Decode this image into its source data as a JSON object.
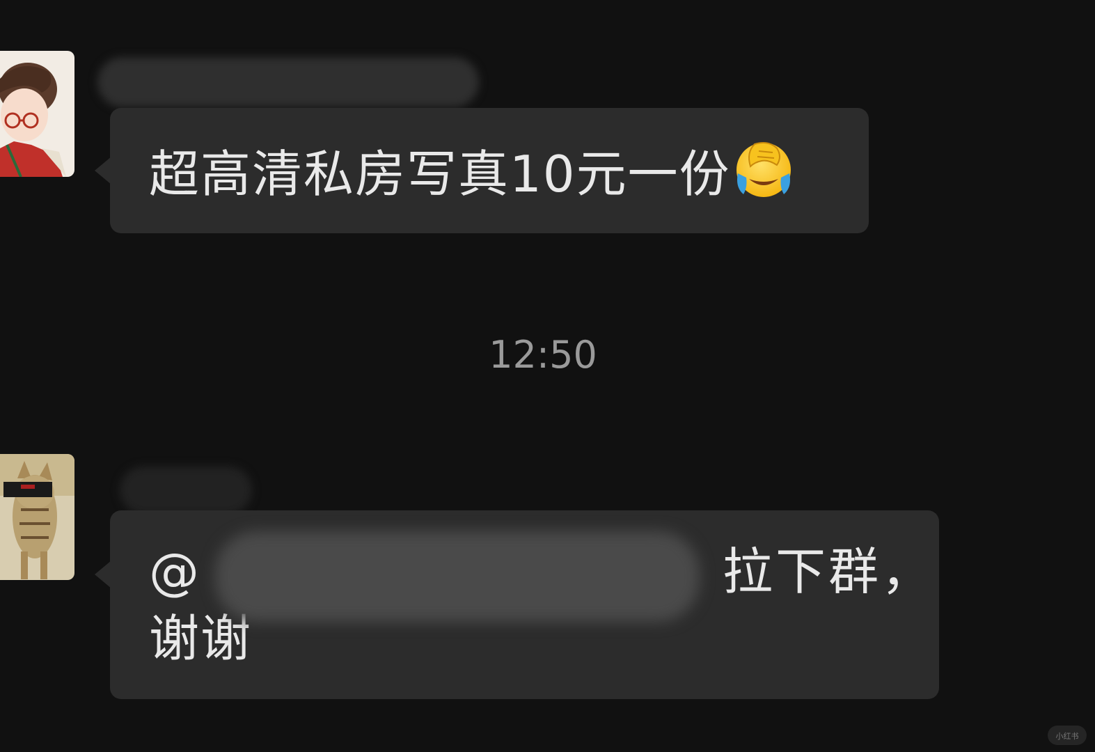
{
  "chat": {
    "messages": [
      {
        "text": "超高清私房写真10元一份",
        "emoji": "face-exhaling-laughing-emoji"
      },
      {
        "mention_prefix": "@",
        "mention_suffix": "拉下群，",
        "second_line": "谢谢"
      }
    ],
    "timestamp": "12:50"
  },
  "watermark": {
    "text": "小红书"
  },
  "colors": {
    "background": "#111111",
    "bubble": "#2c2c2c",
    "text": "#e9e9e9",
    "timestamp": "#9a9a9a"
  }
}
